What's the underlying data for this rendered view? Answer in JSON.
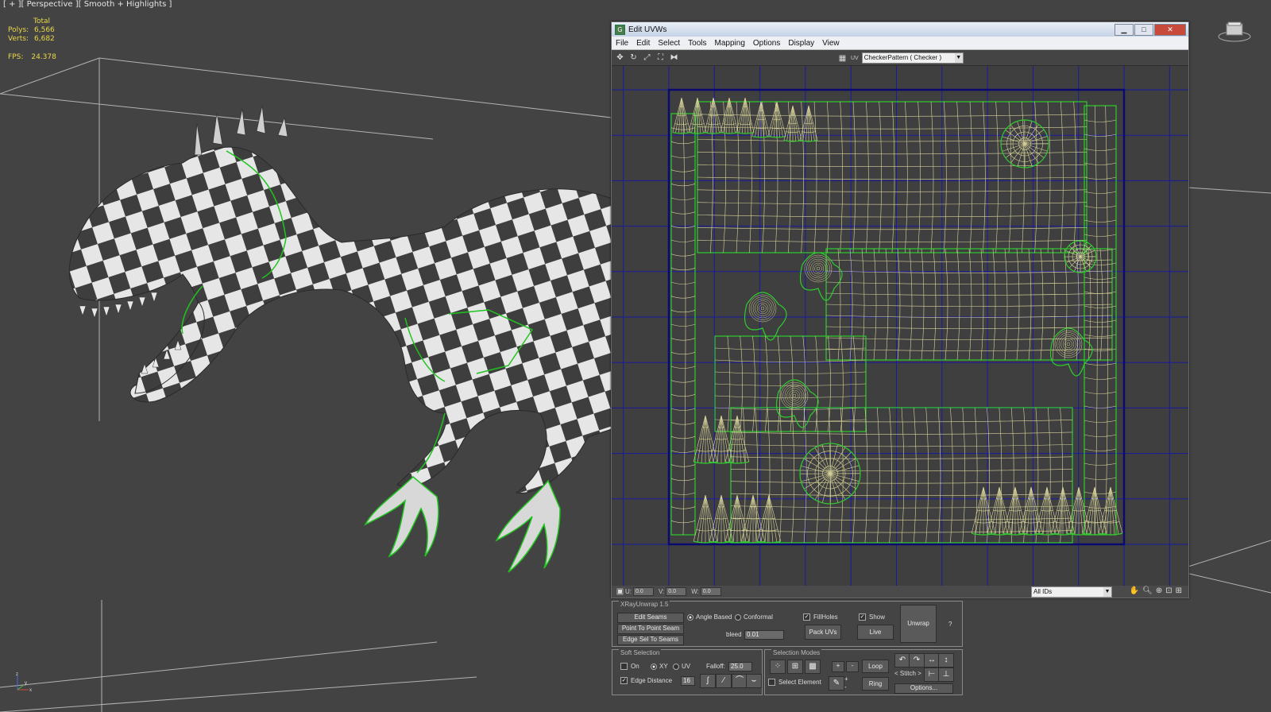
{
  "viewport": {
    "label": "[ + ][ Perspective ][ Smooth + Highlights ]",
    "stats": {
      "total_label": "Total",
      "polys_label": "Polys:",
      "polys_value": "6,566",
      "verts_label": "Verts:",
      "verts_value": "6,682",
      "fps_label": "FPS:",
      "fps_value": "24.378"
    },
    "axis": {
      "x": "x",
      "y": "y",
      "z": "z"
    }
  },
  "uvw_window": {
    "title": "Edit UVWs",
    "window_buttons": [
      "▁",
      "□",
      "✕"
    ],
    "menu": [
      "File",
      "Edit",
      "Select",
      "Tools",
      "Mapping",
      "Options",
      "Display",
      "View"
    ],
    "uv_label": "UV",
    "texture_dropdown": "CheckerPattern ( Checker )",
    "status": {
      "u_label": "U:",
      "u_value": "0.0",
      "v_label": "V:",
      "v_value": "0.0",
      "w_label": "W:",
      "w_value": "0.0",
      "ids_dropdown": "All IDs"
    }
  },
  "xray_unwrap": {
    "title": "XRayUnwrap 1.5",
    "edit_seams": "Edit Seams",
    "point_to_point": "Point To Point Seam",
    "edge_sel_to_seams": "Edge Sel To Seams",
    "angle_based": "Angle Based",
    "conformal": "Conformal",
    "fill_holes": "FillHoles",
    "show": "Show",
    "pack_uvs": "Pack UVs",
    "live": "Live",
    "unwrap": "Unwrap",
    "help": "?",
    "bleed_label": "bleed",
    "bleed_value": "0.01"
  },
  "soft_selection": {
    "title": "Soft Selection",
    "on": "On",
    "xy": "XY",
    "uv": "UV",
    "falloff_label": "Falloff:",
    "falloff_value": "25.0",
    "edge_distance": "Edge Distance",
    "edge_distance_value": "16"
  },
  "selection_modes": {
    "title": "Selection Modes",
    "select_element": "Select Element",
    "plus": "+",
    "minus": "-",
    "loop": "Loop",
    "ring": "Ring",
    "stitch": "Stitch",
    "stitch_left": "<",
    "stitch_right": ">",
    "options": "Options..."
  },
  "colors": {
    "viewport_bg": "#434343",
    "stats_text": "#e8d84a",
    "uv_grid_line": "#1a1aa0",
    "uv_border": "#0a0a70",
    "uv_wire": "#d8d49a",
    "uv_seam": "#2ecc2e"
  }
}
